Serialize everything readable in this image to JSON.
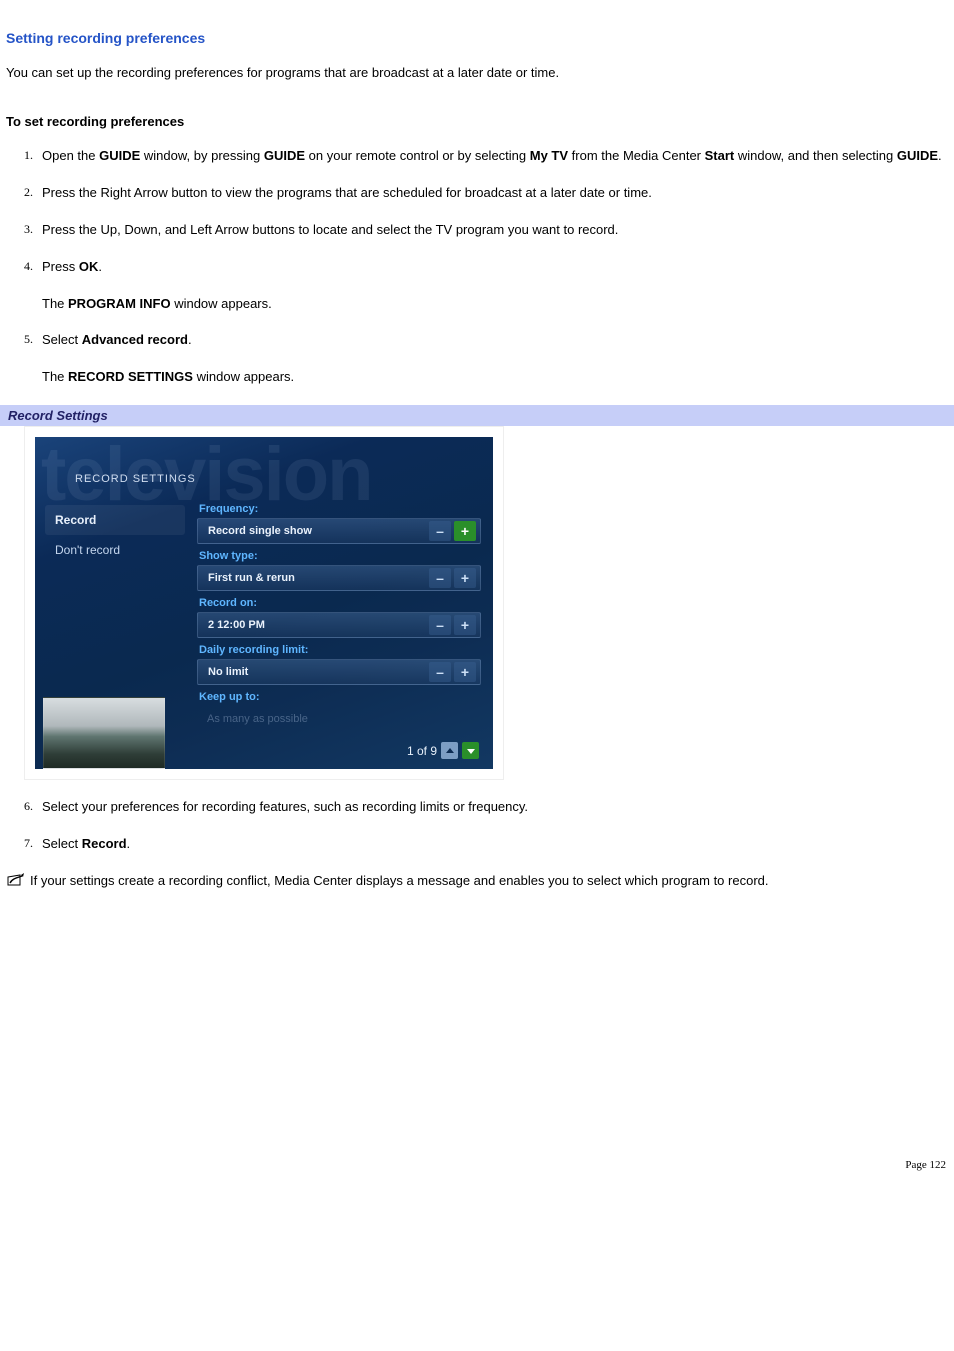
{
  "page": {
    "title": "Setting recording preferences",
    "intro": "You can set up the recording preferences for programs that are broadcast at a later date or time.",
    "subhead": "To set recording preferences",
    "footer": "Page 122"
  },
  "steps": [
    {
      "n": "1.",
      "parts": [
        "Open the ",
        "GUIDE",
        " window, by pressing ",
        "GUIDE",
        " on your remote control or by selecting ",
        "My TV",
        " from the Media Center ",
        "Start",
        " window, and then selecting ",
        "GUIDE",
        "."
      ]
    },
    {
      "n": "2.",
      "text": "Press the Right Arrow button to view the programs that are scheduled for broadcast at a later date or time."
    },
    {
      "n": "3.",
      "text": "Press the Up, Down, and Left Arrow buttons to locate and select the TV program you want to record."
    },
    {
      "n": "4.",
      "parts": [
        "Press ",
        "OK",
        "."
      ],
      "follow": {
        "parts": [
          "The ",
          "PROGRAM INFO",
          " window appears."
        ]
      }
    },
    {
      "n": "5.",
      "parts": [
        "Select ",
        "Advanced record",
        "."
      ],
      "follow": {
        "parts": [
          "The ",
          "RECORD SETTINGS",
          " window appears."
        ]
      }
    },
    {
      "n": "6.",
      "text": "Select your preferences for recording features, such as recording limits or frequency."
    },
    {
      "n": "7.",
      "parts": [
        "Select ",
        "Record",
        "."
      ]
    }
  ],
  "record_settings_header": "Record Settings",
  "screenshot": {
    "bg_word": "television",
    "header": "RECORD SETTINGS",
    "sidebar": [
      {
        "label": "Record",
        "selected": true
      },
      {
        "label": "Don't record",
        "selected": false
      }
    ],
    "groups": [
      {
        "label": "Frequency:",
        "value": "Record single show",
        "highlight_plus": true
      },
      {
        "label": "Show type:",
        "value": "First run & rerun",
        "highlight_plus": false
      },
      {
        "label": "Record on:",
        "value": "2  12:00 PM",
        "highlight_plus": false
      },
      {
        "label": "Daily recording limit:",
        "value": "No limit",
        "highlight_plus": false
      }
    ],
    "keepup": {
      "label": "Keep up to:",
      "value": "As many as possible"
    },
    "pager": "1 of 9",
    "spin": {
      "minus": "–",
      "plus": "+"
    }
  },
  "note": "If your settings create a recording conflict, Media Center displays a message and enables you to select which program to record."
}
